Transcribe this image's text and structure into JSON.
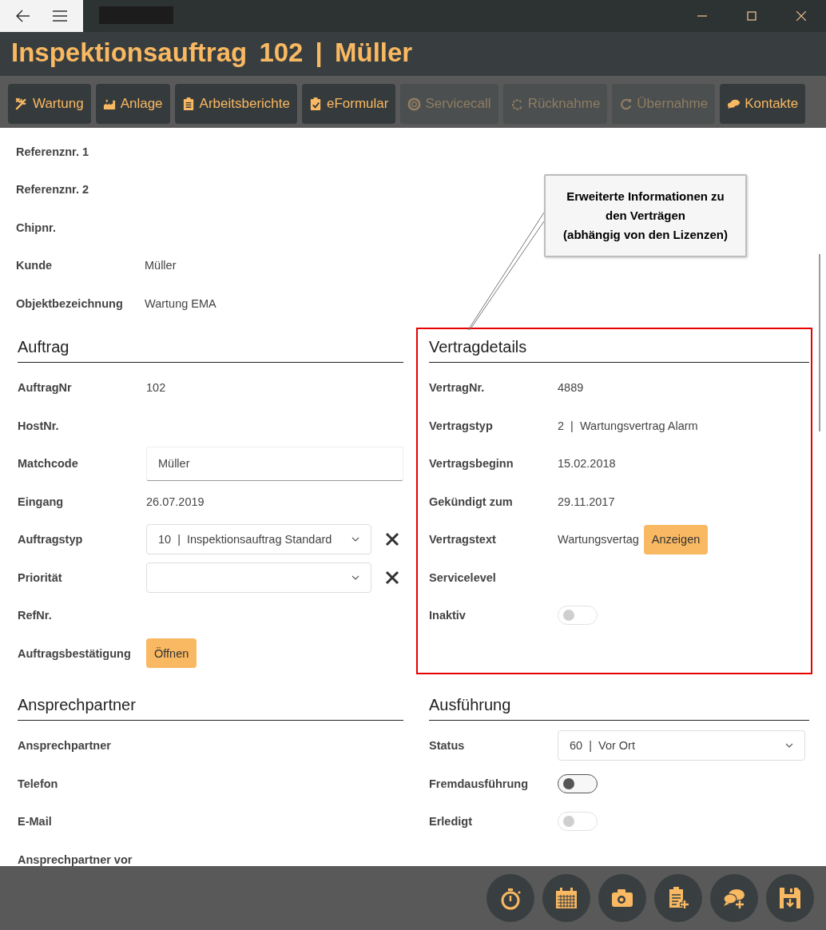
{
  "header": {
    "title": "Inspektionsauftrag 102 | Müller"
  },
  "toolbar": [
    {
      "label": "Wartung",
      "disabled": false
    },
    {
      "label": "Anlage",
      "disabled": false
    },
    {
      "label": "Arbeitsberichte",
      "disabled": false
    },
    {
      "label": "eFormular",
      "disabled": false
    },
    {
      "label": "Servicecall",
      "disabled": true
    },
    {
      "label": "Rücknahme",
      "disabled": true
    },
    {
      "label": "Übernahme",
      "disabled": true
    },
    {
      "label": "Kontakte",
      "disabled": false
    }
  ],
  "summary_fields": [
    {
      "label": "Referenznr. 1",
      "kind": "text"
    },
    {
      "label": "Referenznr. 2",
      "kind": "text"
    },
    {
      "label": "Chipnr.",
      "kind": "text"
    },
    {
      "label": "Kunde",
      "kind": "text",
      "value": "Müller"
    },
    {
      "label": "Objektbezeichnung",
      "kind": "text",
      "value": "Wartung EMA"
    }
  ],
  "callout": {
    "text": "Erweiterte Informationen zu\nden Verträgen\n(abhängig von den Lizenzen)"
  },
  "sections": [
    {
      "title": "Auftrag",
      "highlighted": false,
      "fields": [
        {
          "label": "AuftragNr",
          "kind": "text",
          "value": "102"
        },
        {
          "label": "HostNr.",
          "kind": "text"
        },
        {
          "label": "Matchcode",
          "kind": "input",
          "value": "Müller"
        },
        {
          "label": "Eingang",
          "kind": "text",
          "value": "26.07.2019"
        },
        {
          "label": "Auftragstyp",
          "kind": "select",
          "value": "10  |  Inspektionsauftrag Standard",
          "clearable": true
        },
        {
          "label": "Priorität",
          "kind": "select",
          "clearable": true
        },
        {
          "label": "RefNr.",
          "kind": "text"
        },
        {
          "label": "Auftragsbestätigung",
          "kind": "button",
          "button_label": "Öffnen"
        }
      ]
    },
    {
      "title": "Vertragdetails",
      "highlighted": true,
      "fields": [
        {
          "label": "VertragNr.",
          "kind": "text",
          "value": "4889"
        },
        {
          "label": "Vertragstyp",
          "kind": "text",
          "value": "2  |  Wartungsvertrag Alarm"
        },
        {
          "label": "Vertragsbeginn",
          "kind": "text",
          "value": "15.02.2018"
        },
        {
          "label": "Gekündigt zum",
          "kind": "text",
          "value": "29.11.2017"
        },
        {
          "label": "Vertragstext",
          "kind": "text_button",
          "value": "Wartungsvertag",
          "button_label": "Anzeigen"
        },
        {
          "label": "Servicelevel",
          "kind": "text"
        },
        {
          "label": "Inaktiv",
          "kind": "toggle",
          "checked": false,
          "disabled": true
        }
      ]
    },
    {
      "title": "Ansprechpartner",
      "highlighted": false,
      "fields": [
        {
          "label": "Ansprechpartner",
          "kind": "text"
        },
        {
          "label": "Telefon",
          "kind": "text"
        },
        {
          "label": "E-Mail",
          "kind": "text"
        },
        {
          "label": "Ansprechpartner vor",
          "kind": "text"
        }
      ]
    },
    {
      "title": "Ausführung",
      "highlighted": false,
      "fields": [
        {
          "label": "Status",
          "kind": "select",
          "value": "60  |  Vor Ort",
          "clearable": false
        },
        {
          "label": "Fremdausführung",
          "kind": "toggle",
          "checked": false,
          "disabled": false
        },
        {
          "label": "Erledigt",
          "kind": "toggle",
          "checked": false,
          "disabled": true
        }
      ]
    }
  ]
}
